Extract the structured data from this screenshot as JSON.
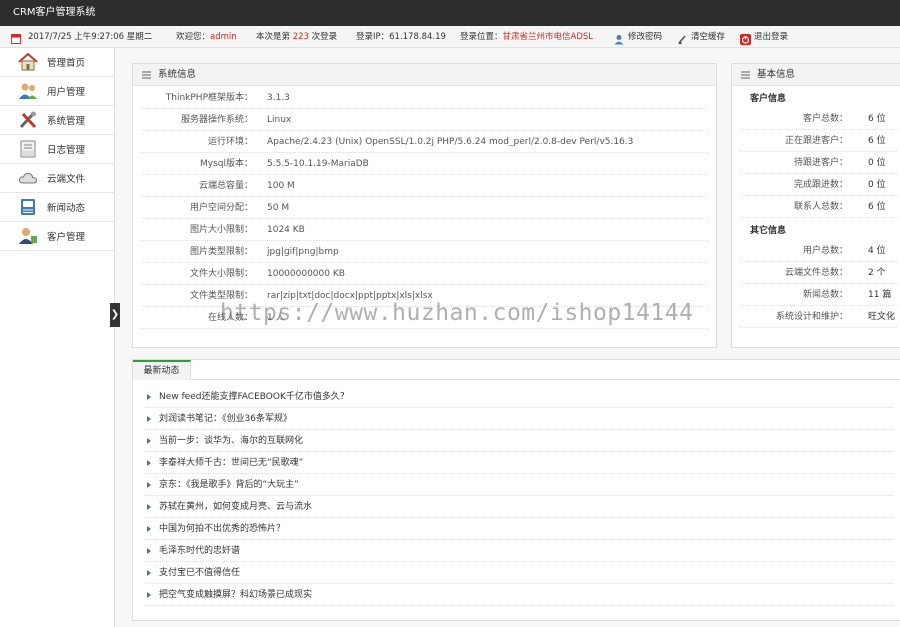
{
  "header": {
    "title": "CRM客户管理系统"
  },
  "infobar": {
    "date": "2017/7/25 上午9:27:06 星期二",
    "welcome_label": "欢迎您：",
    "welcome_user": "admin",
    "login_prefix": "本次是第",
    "login_count": "223",
    "login_suffix": "次登录",
    "ip": "登录IP：61.178.84.19",
    "location_label": "登录位置：",
    "location_value": "甘肃省兰州市电信ADSL",
    "change_pwd": "修改密码",
    "clear_cache": "清空缓存",
    "logout": "退出登录"
  },
  "sidebar": {
    "items": [
      {
        "label": "管理首页",
        "icon": "home-icon"
      },
      {
        "label": "用户管理",
        "icon": "users-icon"
      },
      {
        "label": "系统管理",
        "icon": "tools-icon"
      },
      {
        "label": "日志管理",
        "icon": "log-icon"
      },
      {
        "label": "云端文件",
        "icon": "cloud-icon"
      },
      {
        "label": "新闻动态",
        "icon": "news-icon"
      },
      {
        "label": "客户管理",
        "icon": "customer-icon"
      }
    ]
  },
  "sysinfo": {
    "title": "系统信息",
    "rows": [
      {
        "k": "ThinkPHP框架版本：",
        "v": "3.1.3",
        "red": false
      },
      {
        "k": "服务器操作系统：",
        "v": "Linux",
        "red": false
      },
      {
        "k": "运行环境：",
        "v": "Apache/2.4.23 (Unix) OpenSSL/1.0.2j PHP/5.6.24 mod_perl/2.0.8-dev Perl/v5.16.3",
        "red": false
      },
      {
        "k": "Mysql版本：",
        "v": "5.5.5-10.1.19-MariaDB",
        "red": false
      },
      {
        "k": "云端总容量：",
        "v": "100 M",
        "red": true
      },
      {
        "k": "用户空间分配：",
        "v": "50 M",
        "red": true
      },
      {
        "k": "图片大小限制：",
        "v": "1024 KB",
        "red": true
      },
      {
        "k": "图片类型限制：",
        "v": "jpg|gif|png|bmp",
        "red": false
      },
      {
        "k": "文件大小限制：",
        "v": "10000000000 KB",
        "red": true
      },
      {
        "k": "文件类型限制：",
        "v": "rar|zip|txt|doc|docx|ppt|pptx|xls|xlsx",
        "red": false
      },
      {
        "k": "在线人数：",
        "v": "1 人",
        "red": true
      }
    ]
  },
  "basic": {
    "title": "基本信息",
    "customer_section": "客户信息",
    "customer_rows": [
      {
        "k": "客户总数：",
        "v": "6 位"
      },
      {
        "k": "正在跟进客户：",
        "v": "6 位"
      },
      {
        "k": "待跟进客户：",
        "v": "0 位"
      },
      {
        "k": "完成跟进数：",
        "v": "0 位"
      },
      {
        "k": "联系人总数：",
        "v": "6 位"
      }
    ],
    "other_section": "其它信息",
    "other_rows": [
      {
        "k": "用户总数：",
        "v": "4 位"
      },
      {
        "k": "云端文件总数：",
        "v": "2 个"
      },
      {
        "k": "新闻总数：",
        "v": "11 篇"
      },
      {
        "k": "系统设计和维护：",
        "v": "旺文化"
      }
    ]
  },
  "news": {
    "tab": "最新动态",
    "items": [
      "New feed还能支撑FACEBOOK千亿市值多久？",
      "刘润读书笔记：《创业36条军规》",
      "当前一步：谈华为、海尔的互联网化",
      "李泰祥大师千古：世间已无“民歌魂”",
      "京东：《我是歌手》背后的“大玩主”",
      "苏轼在黄州，如何变成月亮、云与流水",
      "中国为何拍不出优秀的恐怖片？",
      "毛泽东时代的忠奸谱",
      "支付宝已不值得信任",
      "把空气变成触摸屏？科幻场景已成现实"
    ]
  },
  "watermark": "https://www.huzhan.com/ishop14144",
  "colors": {
    "accent_red": "#d9261c",
    "tab_green": "#2b9f3f",
    "topbar": "#2d2d2d"
  }
}
